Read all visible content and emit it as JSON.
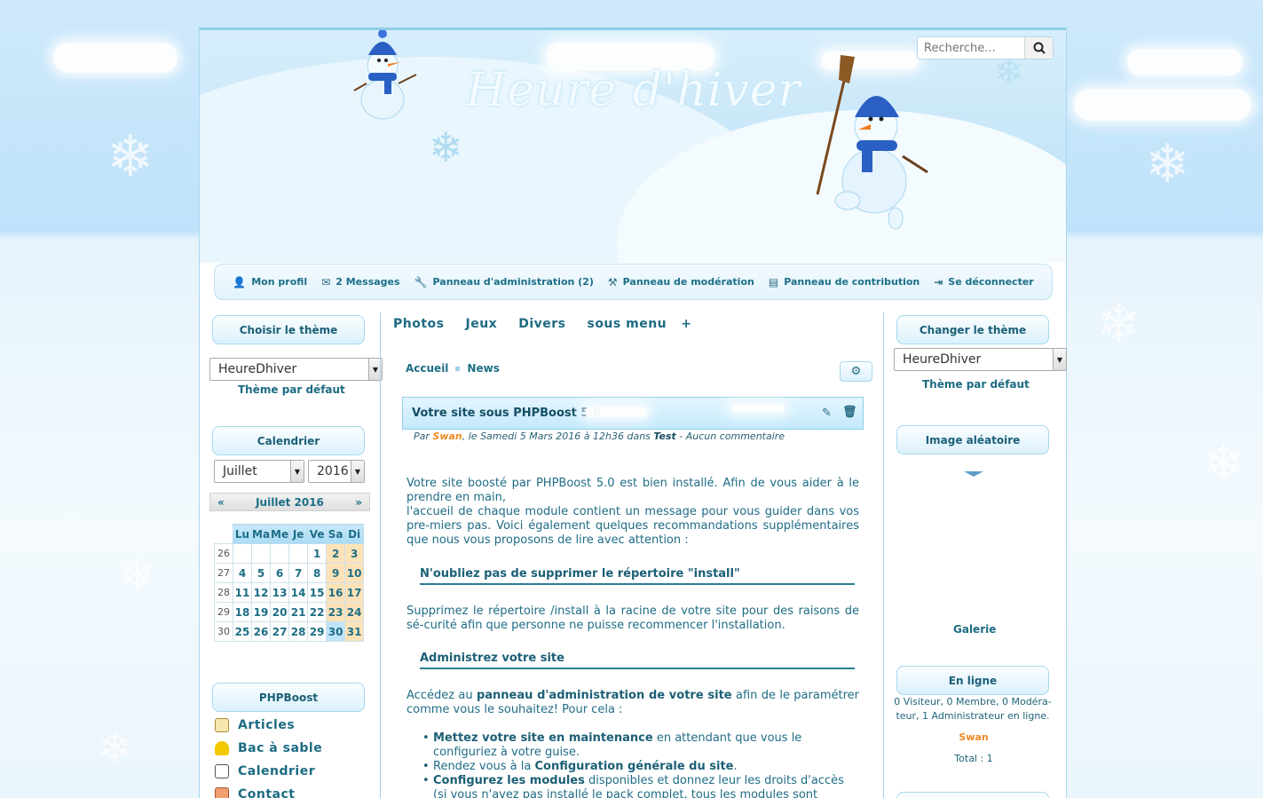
{
  "search": {
    "placeholder": "Recherche..."
  },
  "header": {
    "logo": "Heure d'hiver"
  },
  "userbar": {
    "items": [
      {
        "label": "Mon profil",
        "icon": "user-icon"
      },
      {
        "label": "2 Messages",
        "icon": "envelope-icon"
      },
      {
        "label": "Panneau d'administration (2)",
        "icon": "wrench-icon"
      },
      {
        "label": "Panneau de modération",
        "icon": "gavel-icon"
      },
      {
        "label": "Panneau de contribution",
        "icon": "document-icon"
      },
      {
        "label": "Se déconnecter",
        "icon": "sign-out-icon"
      }
    ]
  },
  "left": {
    "theme_title": "Choisir le thème",
    "theme_select": "HeureDhiver",
    "theme_default": "Thème par défaut",
    "calendar_title": "Calendrier",
    "month_select": "Juillet",
    "year_select": "2016",
    "cal_header": "Juillet 2016",
    "prev": "«",
    "next": "»",
    "days": [
      "Lu",
      "Ma",
      "Me",
      "Je",
      "Ve",
      "Sa",
      "Di"
    ],
    "weeks": [
      {
        "wk": "26",
        "d": [
          "",
          "",
          "",
          "",
          "1",
          "2",
          "3"
        ]
      },
      {
        "wk": "27",
        "d": [
          "4",
          "5",
          "6",
          "7",
          "8",
          "9",
          "10"
        ]
      },
      {
        "wk": "28",
        "d": [
          "11",
          "12",
          "13",
          "14",
          "15",
          "16",
          "17"
        ]
      },
      {
        "wk": "29",
        "d": [
          "18",
          "19",
          "20",
          "21",
          "22",
          "23",
          "24"
        ]
      },
      {
        "wk": "30",
        "d": [
          "25",
          "26",
          "27",
          "28",
          "29",
          "30",
          "31"
        ]
      }
    ],
    "phpboost_title": "PHPBoost",
    "menu": [
      {
        "label": "Articles",
        "icon": "pencil-note-icon"
      },
      {
        "label": "Bac à sable",
        "icon": "helmet-icon"
      },
      {
        "label": "Calendrier",
        "icon": "calendar-icon"
      },
      {
        "label": "Contact",
        "icon": "contact-icon"
      }
    ]
  },
  "center": {
    "nav": [
      "Photos",
      "Jeux",
      "Divers",
      "sous menu"
    ],
    "nav_plus": "+",
    "crumb": [
      "Accueil",
      "News"
    ],
    "article_title": "Votre site sous PHPBoost 5.0",
    "meta": {
      "par": "Par",
      "author": "Swan",
      "date": ", le Samedi 5 Mars 2016 à 12h36 dans",
      "category": "Test",
      "comments": "- Aucun commentaire"
    },
    "p1": "Votre site boosté par PHPBoost 5.0 est bien installé. Afin de vous aider à le prendre en main,",
    "p1b": "l'accueil de chaque module contient un message pour vous guider dans vos pre-miers pas. Voici également quelques recommandations supplémentaires que nous vous proposons de lire avec attention :",
    "h1": "N'oubliez pas de supprimer le répertoire \"install\"",
    "p2": "Supprimez le répertoire /install à la racine de votre site pour des raisons de sé-curité afin que personne ne puisse recommencer l'installation.",
    "h2": "Administrez votre site",
    "p3a": "Accédez au",
    "p3b": "panneau d'administration de votre site",
    "p3c": "afin de le paramétrer comme vous le souhaitez! Pour cela :",
    "bullets": [
      {
        "b": "Mettez votre site en maintenance",
        "t": " en attendant que vous le configuriez à votre guise."
      },
      {
        "pre": "Rendez vous à la ",
        "b": "Configuration générale du site",
        "t": "."
      },
      {
        "b": "Configurez les modules",
        "t": " disponibles et donnez leur les droits d'accès (si vous n'avez pas installé le pack complet, tous les modules sont disponibles"
      }
    ]
  },
  "right": {
    "theme_title": "Changer le thème",
    "theme_select": "HeureDhiver",
    "theme_default": "Thème par défaut",
    "image_title": "Image aléatoire",
    "galerie": "Galerie",
    "online_title": "En ligne",
    "online_text": "0 Visiteur, 0 Membre, 0 Modéra-teur, 1 Administrateur en ligne.",
    "online_user": "Swan",
    "total": "Total : 1"
  }
}
